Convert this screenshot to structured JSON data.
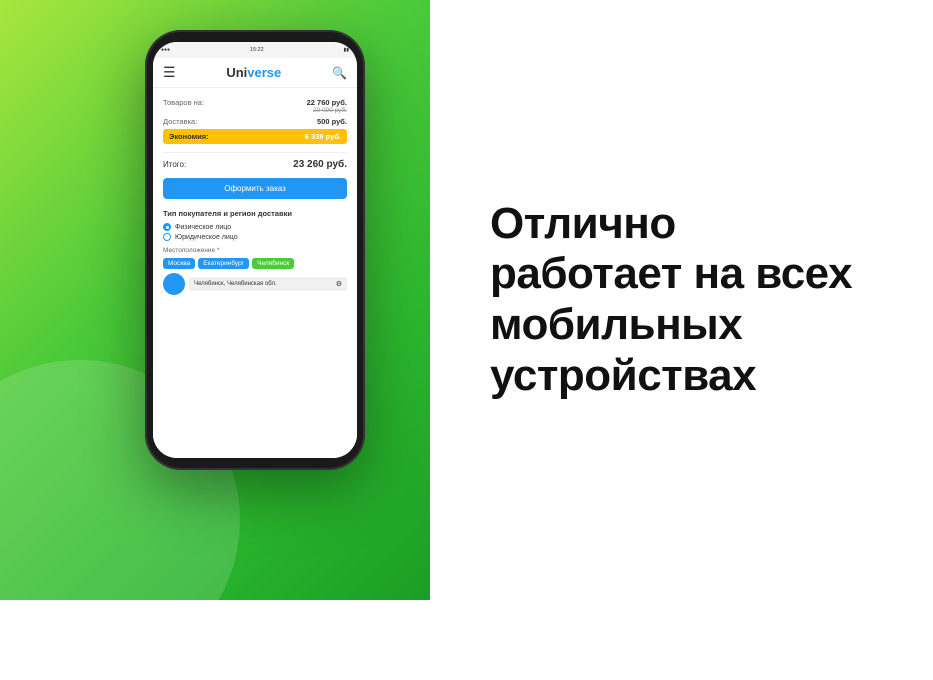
{
  "background": {
    "gradient_start": "#a8e63d",
    "gradient_end": "#1a9e25",
    "white_right": "#ffffff"
  },
  "phone": {
    "status_bar": {
      "time": "15:22",
      "signal": "●●●",
      "battery": "▮"
    },
    "header": {
      "hamburger_icon": "☰",
      "logo_part1": "Uni",
      "logo_part2": "verse",
      "search_icon": "🔍"
    },
    "order_summary": {
      "goods_label": "Товаров на:",
      "goods_value": "22 760 руб.",
      "goods_old_value": "29 099 руб.",
      "delivery_label": "Доставка:",
      "delivery_value": "500 руб.",
      "economy_label": "Экономия:",
      "economy_value": "6 339 руб.",
      "total_label": "Итого:",
      "total_value": "23 260 руб.",
      "order_button": "Оформить заказ"
    },
    "buyer_section": {
      "title": "Тип покупателя и регион доставки",
      "option1": "Физическое лицо",
      "option2": "Юридическое лицо",
      "location_label": "Местоположение *",
      "chips": [
        "Москва",
        "Екатеринбург",
        "Челябинск"
      ],
      "city_input_value": "Челябинск, Челябинская обл.",
      "settings_icon": "⚙"
    }
  },
  "headline": {
    "line1": "Отлично",
    "line2": "работает на всех",
    "line3": "мобильных",
    "line4": "устройствах"
  }
}
